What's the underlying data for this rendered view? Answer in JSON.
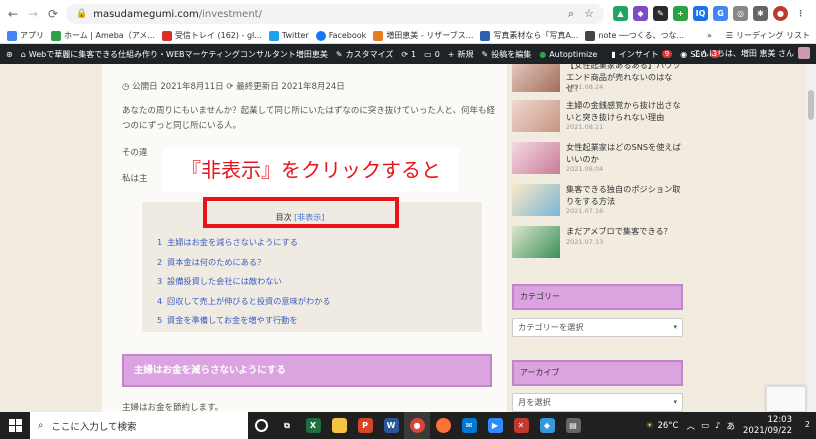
{
  "browser": {
    "url_host": "masudamegumi.com",
    "url_path": "/investment/",
    "bookmarks": [
      {
        "label": "アプリ",
        "color": "#4285f4"
      },
      {
        "label": "ホーム | Ameba（アメ...",
        "color": "#2ca248"
      },
      {
        "label": "受信トレイ (162) - gl...",
        "color": "#d93025"
      },
      {
        "label": "Twitter",
        "color": "#1da1f2"
      },
      {
        "label": "Facebook",
        "color": "#1877f2"
      },
      {
        "label": "増田恵美 - リザーブス...",
        "color": "#e67e22"
      },
      {
        "label": "写真素材なら「写真A...",
        "color": "#2b5fb4"
      },
      {
        "label": "note ──つくる、つな...",
        "color": "#444444"
      }
    ],
    "bookmarks_more": "»",
    "reading_list": "リーディング リスト"
  },
  "wpbar": {
    "site": "Webで華麗に集客できる仕組み作り・WEBマーケティングコンサルタント増田恵美",
    "customize": "カスタマイズ",
    "comments": "1",
    "comments_pending": "0",
    "new": "新規",
    "edit": "投稿を編集",
    "autoptimize": "Autoptimize",
    "insight": "インサイト",
    "insight_count": "9",
    "seo": "SEO",
    "seo_count": "3",
    "greeting": "こんにちは、増田 恵美 さん"
  },
  "article": {
    "published": "公開日 2021年8月11日",
    "updated": "最終更新日 2021年8月24日",
    "para1_line1": "あなたの周りにもいませんか？起業して同じ所にいたはずなのに突き抜けていった人と、何年も経",
    "para1_line2": "つのにずっと同じ所にいる人。",
    "para2": "その違",
    "para3": "私は主",
    "overlay_caption": "『非表示』をクリックすると",
    "toc_title": "目次",
    "toc_toggle": "[非表示]",
    "toc_items": [
      {
        "num": "1",
        "text": "主婦はお金を減らさないようにする"
      },
      {
        "num": "2",
        "text": "資本金は何のためにある？"
      },
      {
        "num": "3",
        "text": "設備投資した会社には敵わない"
      },
      {
        "num": "4",
        "text": "回収して売上が伸びると投資の意味がわかる"
      },
      {
        "num": "5",
        "text": "資金を準備してお金を増やす行動を"
      }
    ],
    "section_heading": "主婦はお金を減らさないようにする",
    "section_text": "主婦はお金を節約します。"
  },
  "sidebar": {
    "posts": [
      {
        "title": "【女性起業家あるある】ハウツエンド商品が売れないのはなぜ？",
        "date": "2021.08.24"
      },
      {
        "title": "主婦の金銭感覚から抜け出さないと突き抜けられない理由",
        "date": "2021.08.11"
      },
      {
        "title": "女性起業家はどのSNSを使えばいいのか",
        "date": "2021.08.04"
      },
      {
        "title": "集客できる独自のポジション取りをする方法",
        "date": "2021.07.16"
      },
      {
        "title": "まだアメブロで集客できる？",
        "date": "2021.07.13"
      }
    ],
    "category_title": "カテゴリー",
    "category_select": "カテゴリーを選択",
    "archive_title": "アーカイブ",
    "archive_select": "月を選択"
  },
  "taskbar": {
    "search_placeholder": "ここに入力して検索",
    "temperature": "26°C",
    "ime": "あ",
    "time": "12:03",
    "date": "2021/09/22",
    "notifications": "2"
  }
}
